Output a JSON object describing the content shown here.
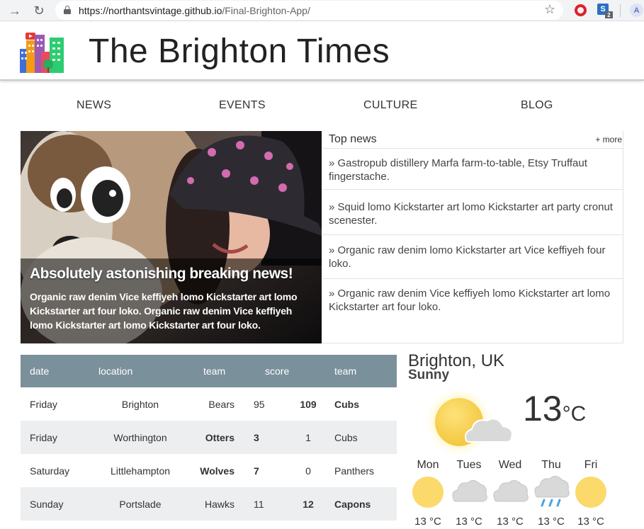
{
  "browser": {
    "url_host": "https://northantsvintage.github.io",
    "url_path": "/Final-Brighton-App/",
    "profile_initial": "A",
    "ext_badge": "2"
  },
  "site": {
    "title": "The Brighton Times"
  },
  "nav": [
    "NEWS",
    "EVENTS",
    "CULTURE",
    "BLOG"
  ],
  "hero": {
    "title": "Absolutely astonishing breaking news!",
    "text": "Organic raw denim Vice keffiyeh lomo Kickstarter art lomo Kickstarter art four loko. Organic raw denim Vice keffiyeh lomo Kickstarter art lomo Kickstarter art four loko."
  },
  "top_news": {
    "title": "Top news",
    "more": "+ more",
    "items": [
      "» Gastropub distillery Marfa farm-to-table, Etsy Truffaut fingerstache.",
      "» Squid lomo Kickstarter art lomo Kickstarter art party cronut scenester.",
      "» Organic raw denim lomo Kickstarter art Vice keffiyeh four loko.",
      "» Organic raw denim Vice keffiyeh lomo Kickstarter art lomo Kickstarter art four loko."
    ]
  },
  "scores": {
    "headers": [
      "date",
      "location",
      "team",
      "score",
      "team"
    ],
    "rows": [
      {
        "date": "Friday",
        "location": "Brighton",
        "team1": "Bears",
        "score1": "95",
        "score2": "109",
        "team2": "Cubs",
        "winner": 2
      },
      {
        "date": "Friday",
        "location": "Worthington",
        "team1": "Otters",
        "score1": "3",
        "score2": "1",
        "team2": "Cubs",
        "winner": 1
      },
      {
        "date": "Saturday",
        "location": "Littlehampton",
        "team1": "Wolves",
        "score1": "7",
        "score2": "0",
        "team2": "Panthers",
        "winner": 1
      },
      {
        "date": "Sunday",
        "location": "Portslade",
        "team1": "Hawks",
        "score1": "11",
        "score2": "12",
        "team2": "Capons",
        "winner": 2
      }
    ]
  },
  "weather": {
    "location": "Brighton, UK",
    "condition": "Sunny",
    "temp": "13",
    "unit": "°C",
    "icon": "sun-behind-cloud-icon",
    "forecast": [
      {
        "day": "Mon",
        "temp": "13 °C",
        "icon": "sun-icon"
      },
      {
        "day": "Tues",
        "temp": "13 °C",
        "icon": "cloud-icon"
      },
      {
        "day": "Wed",
        "temp": "13 °C",
        "icon": "cloud-icon"
      },
      {
        "day": "Thu",
        "temp": "13 °C",
        "icon": "rain-cloud-icon"
      },
      {
        "day": "Fri",
        "temp": "13 °C",
        "icon": "sun-icon"
      }
    ]
  },
  "colors": {
    "table_header": "#7a909b",
    "table_alt_row": "#eceeef",
    "sun": "#fbd96b"
  }
}
